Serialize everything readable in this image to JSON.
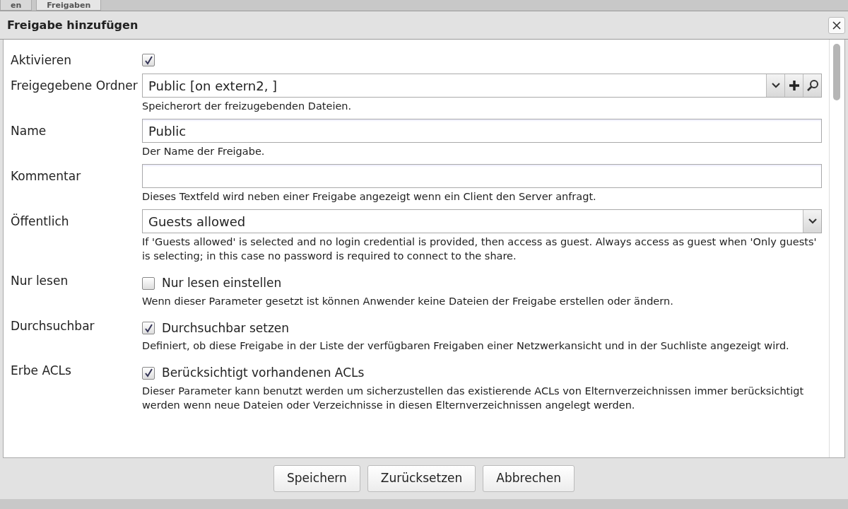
{
  "tabs": [
    {
      "label": "en",
      "selected": false
    },
    {
      "label": "Freigaben",
      "selected": true
    }
  ],
  "dialog": {
    "title": "Freigabe hinzufügen"
  },
  "fields": [
    {
      "kind": "checkbox",
      "label": "Aktivieren",
      "checked": true
    },
    {
      "kind": "combo",
      "label": "Freigegebene Ordner",
      "value": "Public [on extern2,  ]",
      "help": "Speicherort der freizugebenden Dateien."
    },
    {
      "kind": "text",
      "label": "Name",
      "value": "Public",
      "help": "Der Name der Freigabe."
    },
    {
      "kind": "text",
      "label": "Kommentar",
      "help": "Dieses Textfeld wird neben einer Freigabe angezeigt wenn ein Client den Server anfragt."
    },
    {
      "kind": "select",
      "label": "Öffentlich",
      "value": "Guests allowed",
      "help": "If 'Guests allowed' is selected and no login credential is provided, then access as guest. Always access as guest when 'Only guests' is selecting; in this case no password is required to connect to the share."
    },
    {
      "kind": "checkbox",
      "label": "Nur lesen",
      "checked": false,
      "caption": "Nur lesen einstellen",
      "help": "Wenn dieser Parameter gesetzt ist können Anwender keine Dateien der Freigabe erstellen oder ändern."
    },
    {
      "kind": "checkbox",
      "label": "Durchsuchbar",
      "checked": true,
      "caption": "Durchsuchbar setzen",
      "help": "Definiert, ob diese Freigabe in der Liste der verfügbaren Freigaben einer Netzwerkansicht und in der Suchliste angezeigt wird."
    },
    {
      "kind": "checkbox",
      "label": "Erbe ACLs",
      "checked": true,
      "caption": "Berücksichtigt vorhandenen ACLs",
      "help": "Dieser Parameter kann benutzt werden um sicherzustellen das existierende ACLs von Elternverzeichnissen immer berücksichtigt werden wenn neue Dateien oder Verzeichnisse in diesen Elternverzeichnissen angelegt werden."
    }
  ],
  "buttons": [
    "Speichern",
    "Zurücksetzen",
    "Abbrechen"
  ]
}
